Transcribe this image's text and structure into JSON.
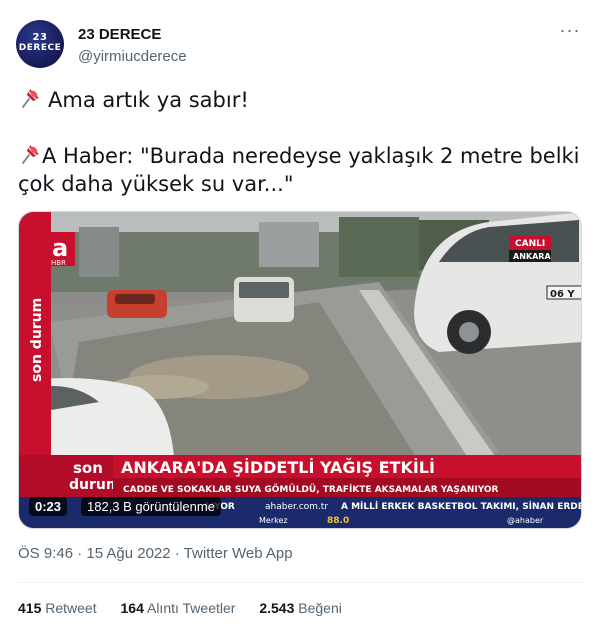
{
  "user": {
    "display_name": "23 DERECE",
    "handle": "@yirmiucderece",
    "avatar_line1": "23",
    "avatar_line2": "DERECE"
  },
  "tweet": {
    "line1": "Ama artık ya sabır!",
    "line2": "A Haber: \"Burada neredeyse yaklaşık 2 metre belki",
    "line3": "çok daha yüksek su var...\"",
    "emoji_icon": "pushpin-icon"
  },
  "video": {
    "duration": "0:23",
    "views": "182,3 B görüntülenme",
    "channel_logo": "a",
    "channel_logo_sub": "HBR",
    "live_label": "CANLI",
    "location_label": "ANKARA",
    "side_logo": "son durum",
    "ticker_logo_line1": "son",
    "ticker_logo_line2": "durum",
    "headline": "ANKARA'DA ŞİDDETLİ YAĞIŞ ETKİLİ",
    "subheadline": "CADDE VE SOKAKLAR SUYA GÖMÜLDÜ, TRAFİKTE AKSAMALAR YAŞANIYOR",
    "ticker_left": "LIYOR",
    "ticker_site": "ahaber.com.tr",
    "ticker_right": "A MİLLİ ERKEK BASKETBOL TAKIMI, SİNAN ERDEM SPOR SA",
    "ticker_sub_label": "Merkez",
    "ticker_sub_value": "88.0",
    "ticker_handle": "@ahaber",
    "plate": "06 Y"
  },
  "meta": {
    "timestamp": "ÖS 9:46 · 15 Ağu 2022 · Twitter Web App"
  },
  "stats": {
    "retweets_count": "415",
    "retweets_label": "Retweet",
    "quotes_count": "164",
    "quotes_label": "Alıntı Tweetler",
    "likes_count": "2.543",
    "likes_label": "Beğeni"
  }
}
